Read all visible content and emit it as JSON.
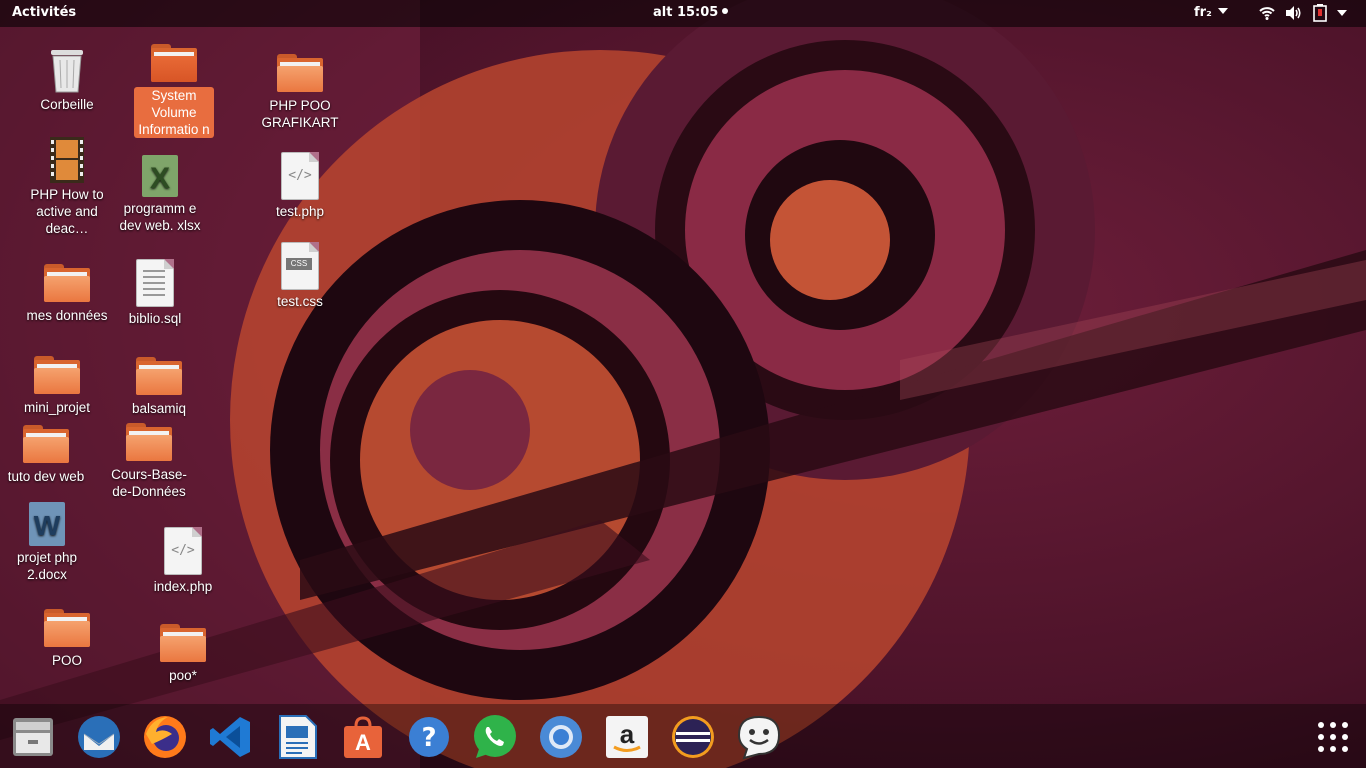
{
  "topbar": {
    "activities": "Activités",
    "clock": "alt 15:05",
    "keyboard_layout": "fr₂"
  },
  "desktop_icons": [
    {
      "label": "Corbeille",
      "kind": "trash"
    },
    {
      "label": "System Volume Informatio n",
      "kind": "folder",
      "selected": true
    },
    {
      "label": "PHP POO GRAFIKART",
      "kind": "folder"
    },
    {
      "label": "PHP How to active and deac…",
      "kind": "video"
    },
    {
      "label": "programm e dev web. xlsx",
      "kind": "xlsx"
    },
    {
      "label": "test.php",
      "kind": "php"
    },
    {
      "label": "test.css",
      "kind": "css"
    },
    {
      "label": "mes données",
      "kind": "folder"
    },
    {
      "label": "biblio.sql",
      "kind": "text"
    },
    {
      "label": "mini_projet",
      "kind": "folder"
    },
    {
      "label": "balsamiq",
      "kind": "folder"
    },
    {
      "label": "tuto dev web",
      "kind": "folder"
    },
    {
      "label": "Cours-Base-de-Données",
      "kind": "folder"
    },
    {
      "label": "projet php 2.docx",
      "kind": "docx"
    },
    {
      "label": "index.php",
      "kind": "php"
    },
    {
      "label": "POO",
      "kind": "folder"
    },
    {
      "label": "poo*",
      "kind": "folder"
    }
  ],
  "dock": [
    {
      "name": "files-icon"
    },
    {
      "name": "thunderbird-icon"
    },
    {
      "name": "firefox-icon"
    },
    {
      "name": "vscode-icon"
    },
    {
      "name": "libreoffice-writer-icon"
    },
    {
      "name": "software-center-icon"
    },
    {
      "name": "help-icon"
    },
    {
      "name": "whatsapp-icon"
    },
    {
      "name": "chromium-icon"
    },
    {
      "name": "amazon-icon"
    },
    {
      "name": "eclipse-icon"
    },
    {
      "name": "pidgin-icon"
    }
  ],
  "colors": {
    "accent": "#e86d3f",
    "folder": "#ea7740",
    "wallpaper_dark": "#3a0f22",
    "wallpaper_orange": "#c14a2c"
  }
}
